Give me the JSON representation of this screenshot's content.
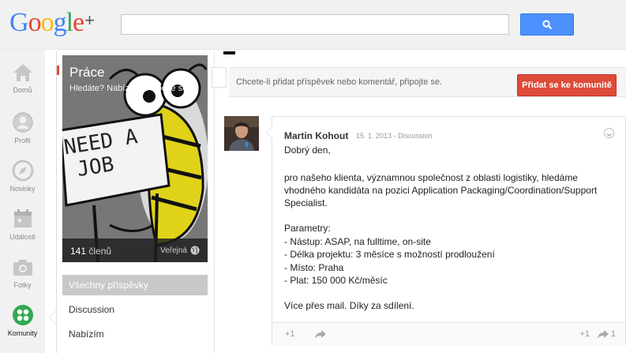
{
  "header": {
    "logo": {
      "g1": "G",
      "o1": "o",
      "o2": "o",
      "g2": "g",
      "l": "l",
      "e": "e",
      "plus": "+"
    }
  },
  "nav": {
    "items": [
      {
        "label": "Domů",
        "icon": "home-icon"
      },
      {
        "label": "Profil",
        "icon": "profile-icon"
      },
      {
        "label": "Novinky",
        "icon": "compass-icon"
      },
      {
        "label": "Události",
        "icon": "calendar-icon"
      },
      {
        "label": "Fotky",
        "icon": "camera-icon"
      },
      {
        "label": "Komunity",
        "icon": "communities-icon"
      }
    ]
  },
  "community": {
    "title": "Práce",
    "tagline": "Hledáte? Nabízíte? Připojte se!",
    "members_count": "141",
    "members_label": "členů",
    "visibility": "Veřejná",
    "sign_text_1": "NEED A",
    "sign_text_2": "JOB",
    "categories": [
      "Všechny příspěvky",
      "Discussion",
      "Nabízím"
    ]
  },
  "join": {
    "text": "Chcete-li přidat příspěvek nebo komentář, připojte se.",
    "button": "Přidat se ke komunitě"
  },
  "post": {
    "author": "Martin Kohout",
    "date": "15. 1. 2013",
    "separator": "-",
    "category": "Discussion",
    "lines": [
      "Dobrý den,",
      "",
      "pro našeho klienta, významnou společnost z oblasti logistiky, hledáme",
      "vhodného kandidáta na pozici Application Packaging/Coordination/Support",
      "Specialist.",
      "",
      "Parametry:",
      "- Nástup: ASAP, na fulltime, on-site",
      "- Délka projektu: 3 měsíce s možností prodloužení",
      "- Místo: Praha",
      "- Plat: 150 000 Kč/měsíc",
      "",
      "Více přes mail. Díky za sdílení."
    ],
    "plus_label": "+1",
    "plus_count": "+1",
    "share_count": "1"
  },
  "colors": {
    "accent_blue": "#4d90fe",
    "join_red": "#dd4b39",
    "community_green": "#34a853"
  }
}
